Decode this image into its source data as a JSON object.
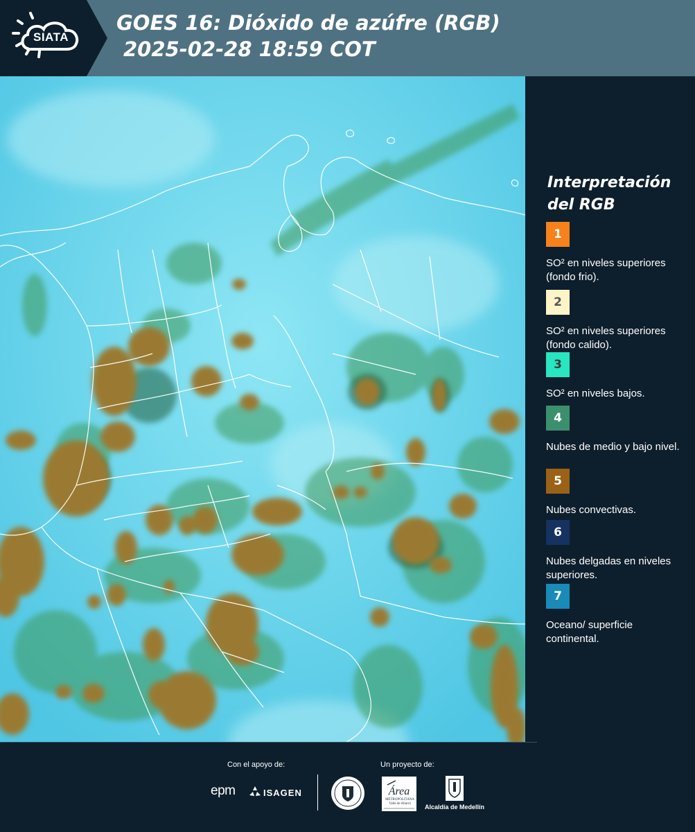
{
  "header": {
    "brand": "SIATA",
    "title_line1": "GOES 16: Dióxido de azúfre (RGB)",
    "title_line2": "2025-02-28 18:59 COT"
  },
  "map": {
    "background_color": "#62d4ec",
    "convective_color": "#9a7a32",
    "low_cloud_color": "#3f9a5a",
    "border_color": "#ffffff"
  },
  "legend": {
    "title": "Interpretación del RGB",
    "items": [
      {
        "number": "1",
        "color": "#f7821b",
        "text_color": "#ffffff",
        "label": "SO² en niveles superiores (fondo frio)."
      },
      {
        "number": "2",
        "color": "#fdf5c7",
        "text_color": "#555555",
        "label": "SO² en niveles superiores (fondo calido)."
      },
      {
        "number": "3",
        "color": "#27e6c0",
        "text_color": "#3a3a3a",
        "label": "SO² en niveles bajos."
      },
      {
        "number": "4",
        "color": "#3c8f6c",
        "text_color": "#ffffff",
        "label": "Nubes de medio y bajo nivel."
      },
      {
        "number": "5",
        "color": "#9b6217",
        "text_color": "#ffffff",
        "label": "Nubes convectivas."
      },
      {
        "number": "6",
        "color": "#153260",
        "text_color": "#ffffff",
        "label": "Nubes delgadas en niveles superiores."
      },
      {
        "number": "7",
        "color": "#1a8ab8",
        "text_color": "#ffffff",
        "label": "Oceano/ superficie continental."
      }
    ]
  },
  "footer": {
    "support_caption": "Con el apoyo de:",
    "project_caption": "Un proyecto de:",
    "epm": "epm",
    "isagen": "ISAGEN",
    "area_logo_text": "Área",
    "area_name": "METROPOLITANA Valle de Aburrá",
    "alcaldia": "Alcaldía de Medellín"
  }
}
